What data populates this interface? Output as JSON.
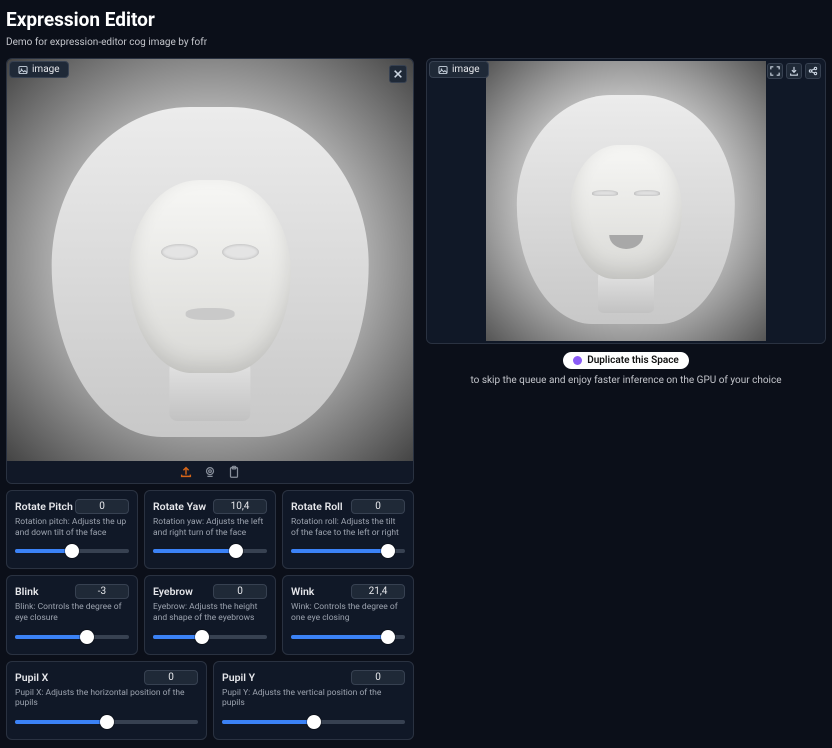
{
  "title": "Expression Editor",
  "subtitle": "Demo for expression-editor cog image by fofr",
  "input_tab_label": "image",
  "output_tab_label": "image",
  "duplicate_button": "Duplicate this Space",
  "duplicate_text": "to skip the queue and enjoy faster inference on the GPU of your choice",
  "icons": {
    "image": "image-icon",
    "close": "close-icon",
    "upload": "upload-icon",
    "webcam": "webcam-icon",
    "clipboard": "clipboard-icon",
    "fullscreen": "fullscreen-icon",
    "download": "download-icon",
    "share": "share-icon"
  },
  "sliders": {
    "row1": [
      {
        "key": "rotate-pitch",
        "label": "Rotate Pitch",
        "value": "0",
        "desc": "Rotation pitch: Adjusts the up and down tilt of the face",
        "pct": 50
      },
      {
        "key": "rotate-yaw",
        "label": "Rotate Yaw",
        "value": "10,4",
        "desc": "Rotation yaw: Adjusts the left and right turn of the face",
        "pct": 73
      },
      {
        "key": "rotate-roll",
        "label": "Rotate Roll",
        "value": "0",
        "desc": "Rotation roll: Adjusts the tilt of the face to the left or right",
        "pct": 85
      }
    ],
    "row2": [
      {
        "key": "blink",
        "label": "Blink",
        "value": "-3",
        "desc": "Blink: Controls the degree of eye closure",
        "pct": 63
      },
      {
        "key": "eyebrow",
        "label": "Eyebrow",
        "value": "0",
        "desc": "Eyebrow: Adjusts the height and shape of the eyebrows",
        "pct": 43
      },
      {
        "key": "wink",
        "label": "Wink",
        "value": "21,4",
        "desc": "Wink: Controls the degree of one eye closing",
        "pct": 85
      }
    ],
    "row3": [
      {
        "key": "pupil-x",
        "label": "Pupil X",
        "value": "0",
        "desc": "Pupil X: Adjusts the horizontal position of the pupils",
        "pct": 50
      },
      {
        "key": "pupil-y",
        "label": "Pupil Y",
        "value": "0",
        "desc": "Pupil Y: Adjusts the vertical position of the pupils",
        "pct": 50
      }
    ]
  }
}
